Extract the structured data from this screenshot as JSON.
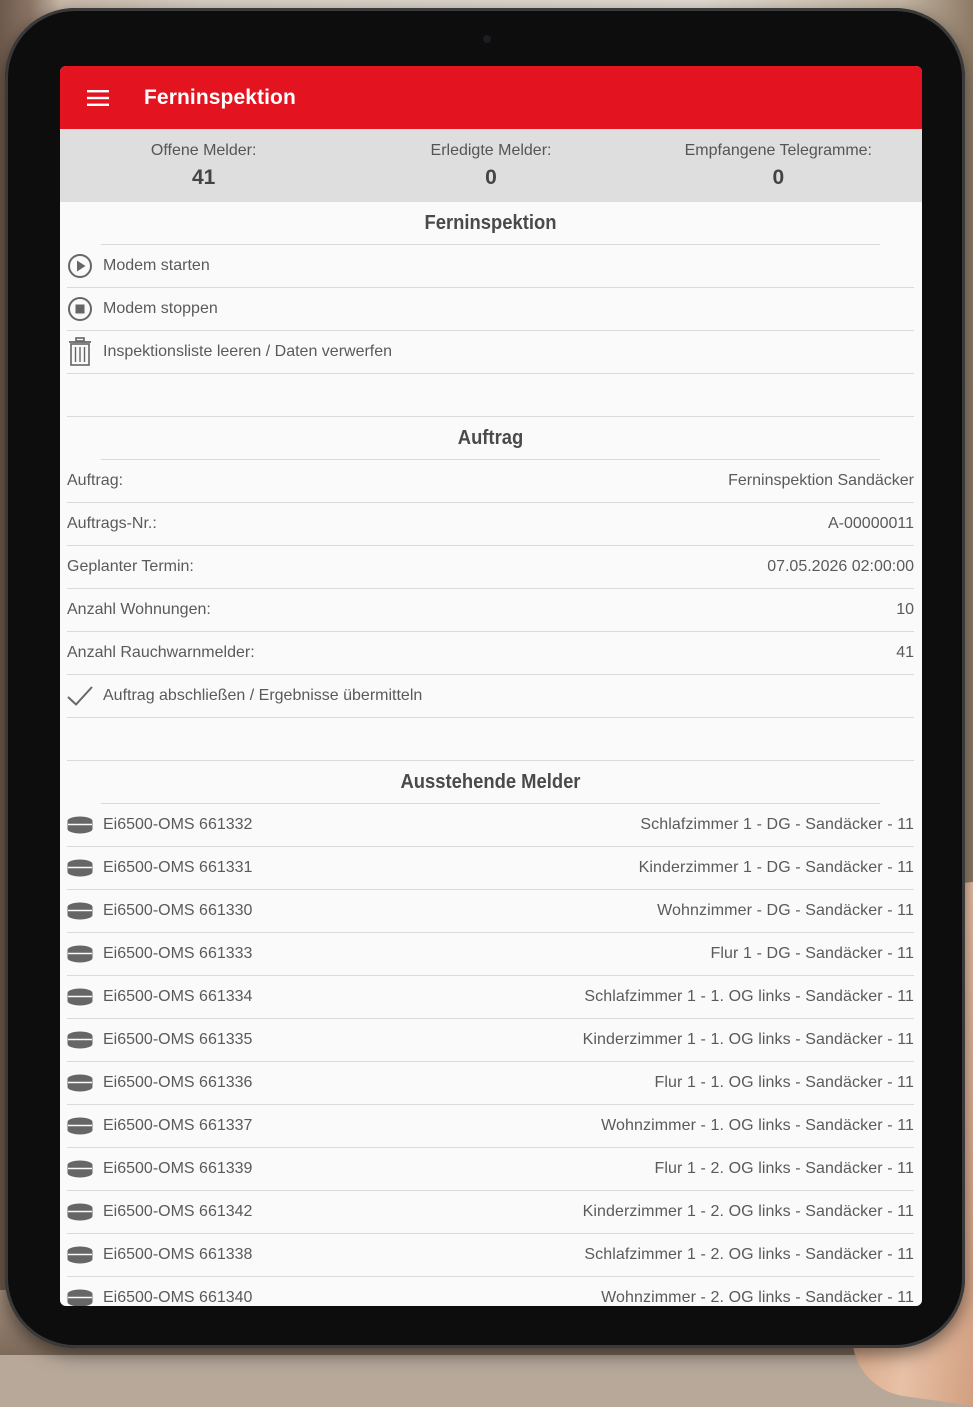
{
  "appbar": {
    "title": "Ferninspektion",
    "menu_icon": "hamburger-menu-icon",
    "color": "#e3141f"
  },
  "stats": [
    {
      "label": "Offene Melder:",
      "value": "41"
    },
    {
      "label": "Erledigte Melder:",
      "value": "0"
    },
    {
      "label": "Empfangene Telegramme:",
      "value": "0"
    }
  ],
  "remote": {
    "title": "Ferninspektion",
    "actions": [
      {
        "label": "Modem starten",
        "icon": "play-circle-icon"
      },
      {
        "label": "Modem stoppen",
        "icon": "stop-circle-icon"
      },
      {
        "label": "Inspektionsliste leeren / Daten verwerfen",
        "icon": "trash-icon"
      }
    ]
  },
  "order": {
    "title": "Auftrag",
    "fields": [
      {
        "label": "Auftrag:",
        "value": "Ferninspektion Sandäcker"
      },
      {
        "label": "Auftrags-Nr.:",
        "value": "A-00000011"
      },
      {
        "label": "Geplanter Termin:",
        "value": "07.05.2026 02:00:00"
      },
      {
        "label": "Anzahl Wohnungen:",
        "value": "10"
      },
      {
        "label": "Anzahl Rauchwarnmelder:",
        "value": "41"
      }
    ],
    "complete_label": "Auftrag abschließen / Ergebnisse übermitteln",
    "complete_icon": "checkmark-icon"
  },
  "pending": {
    "title": "Ausstehende Melder",
    "icon": "smoke-detector-icon",
    "items": [
      {
        "id": "Ei6500-OMS 661332",
        "location": "Schlafzimmer 1 - DG - Sandäcker - 11"
      },
      {
        "id": "Ei6500-OMS 661331",
        "location": "Kinderzimmer 1 - DG - Sandäcker - 11"
      },
      {
        "id": "Ei6500-OMS 661330",
        "location": "Wohnzimmer - DG - Sandäcker - 11"
      },
      {
        "id": "Ei6500-OMS 661333",
        "location": "Flur 1 - DG - Sandäcker - 11"
      },
      {
        "id": "Ei6500-OMS 661334",
        "location": "Schlafzimmer 1 - 1. OG links - Sandäcker - 11"
      },
      {
        "id": "Ei6500-OMS 661335",
        "location": "Kinderzimmer 1 - 1. OG links - Sandäcker - 11"
      },
      {
        "id": "Ei6500-OMS 661336",
        "location": "Flur 1 - 1. OG links - Sandäcker - 11"
      },
      {
        "id": "Ei6500-OMS 661337",
        "location": "Wohnzimmer - 1. OG links - Sandäcker - 11"
      },
      {
        "id": "Ei6500-OMS 661339",
        "location": "Flur 1 - 2. OG links - Sandäcker - 11"
      },
      {
        "id": "Ei6500-OMS 661342",
        "location": "Kinderzimmer 1 - 2. OG links - Sandäcker - 11"
      },
      {
        "id": "Ei6500-OMS 661338",
        "location": "Schlafzimmer 1 - 2. OG links - Sandäcker - 11"
      },
      {
        "id": "Ei6500-OMS 661340",
        "location": "Wohnzimmer - 2. OG links - Sandäcker - 11"
      }
    ]
  }
}
